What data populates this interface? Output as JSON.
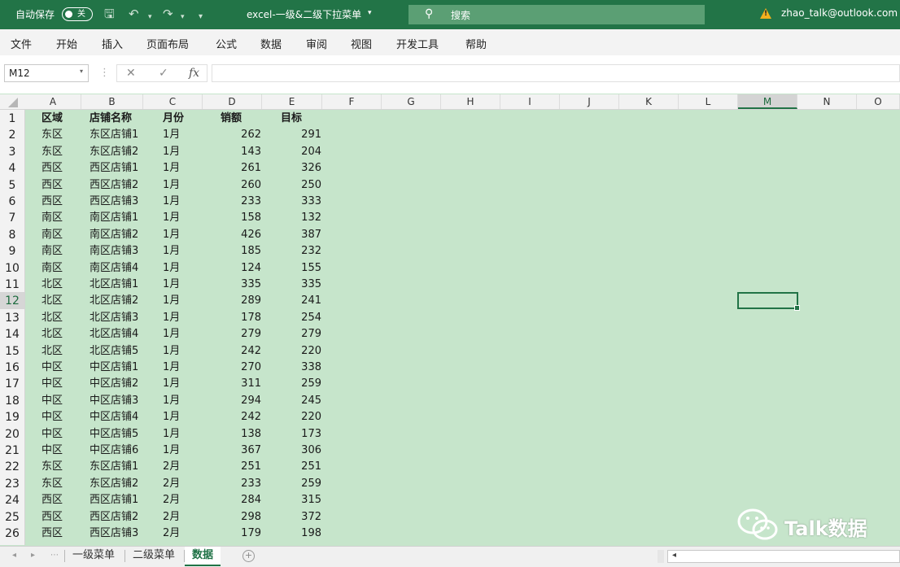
{
  "titlebar": {
    "autosave_label": "自动保存",
    "autosave_state": "关",
    "file_title": "excel-一级&二级下拉菜单",
    "search_placeholder": "搜索",
    "user": "zhao_talk@outlook.com"
  },
  "menu": [
    "文件",
    "开始",
    "插入",
    "页面布局",
    "公式",
    "数据",
    "审阅",
    "视图",
    "开发工具",
    "帮助"
  ],
  "formula_bar": {
    "name_box": "M12",
    "cancel": "✕",
    "confirm": "✓",
    "fx": "fx",
    "content": ""
  },
  "columns": [
    "A",
    "B",
    "C",
    "D",
    "E",
    "F",
    "G",
    "H",
    "I",
    "J",
    "K",
    "L",
    "M",
    "N",
    "O"
  ],
  "selected_column": "M",
  "selected_row": 12,
  "rows": [
    "1",
    "2",
    "3",
    "4",
    "5",
    "6",
    "7",
    "8",
    "9",
    "10",
    "11",
    "12",
    "13",
    "14",
    "15",
    "16",
    "17",
    "18",
    "19",
    "20",
    "21",
    "22",
    "23",
    "24",
    "25",
    "26"
  ],
  "table": {
    "headers": [
      "区域",
      "店铺名称",
      "月份",
      "销额",
      "目标"
    ],
    "rows": [
      [
        "东区",
        "东区店铺1",
        "1月",
        "262",
        "291"
      ],
      [
        "东区",
        "东区店铺2",
        "1月",
        "143",
        "204"
      ],
      [
        "西区",
        "西区店铺1",
        "1月",
        "261",
        "326"
      ],
      [
        "西区",
        "西区店铺2",
        "1月",
        "260",
        "250"
      ],
      [
        "西区",
        "西区店铺3",
        "1月",
        "233",
        "333"
      ],
      [
        "南区",
        "南区店铺1",
        "1月",
        "158",
        "132"
      ],
      [
        "南区",
        "南区店铺2",
        "1月",
        "426",
        "387"
      ],
      [
        "南区",
        "南区店铺3",
        "1月",
        "185",
        "232"
      ],
      [
        "南区",
        "南区店铺4",
        "1月",
        "124",
        "155"
      ],
      [
        "北区",
        "北区店铺1",
        "1月",
        "335",
        "335"
      ],
      [
        "北区",
        "北区店铺2",
        "1月",
        "289",
        "241"
      ],
      [
        "北区",
        "北区店铺3",
        "1月",
        "178",
        "254"
      ],
      [
        "北区",
        "北区店铺4",
        "1月",
        "279",
        "279"
      ],
      [
        "北区",
        "北区店铺5",
        "1月",
        "242",
        "220"
      ],
      [
        "中区",
        "中区店铺1",
        "1月",
        "270",
        "338"
      ],
      [
        "中区",
        "中区店铺2",
        "1月",
        "311",
        "259"
      ],
      [
        "中区",
        "中区店铺3",
        "1月",
        "294",
        "245"
      ],
      [
        "中区",
        "中区店铺4",
        "1月",
        "242",
        "220"
      ],
      [
        "中区",
        "中区店铺5",
        "1月",
        "138",
        "173"
      ],
      [
        "中区",
        "中区店铺6",
        "1月",
        "367",
        "306"
      ],
      [
        "东区",
        "东区店铺1",
        "2月",
        "251",
        "251"
      ],
      [
        "东区",
        "东区店铺2",
        "2月",
        "233",
        "259"
      ],
      [
        "西区",
        "西区店铺1",
        "2月",
        "284",
        "315"
      ],
      [
        "西区",
        "西区店铺2",
        "2月",
        "298",
        "372"
      ],
      [
        "西区",
        "西区店铺3",
        "2月",
        "179",
        "198"
      ]
    ]
  },
  "sheets": [
    "一级菜单",
    "二级菜单",
    "数据"
  ],
  "active_sheet": "数据",
  "watermark": "Talk数据",
  "colors": {
    "excel_green": "#217346",
    "title_green": "#227447",
    "sheet_bg": "#c6e5cb"
  }
}
